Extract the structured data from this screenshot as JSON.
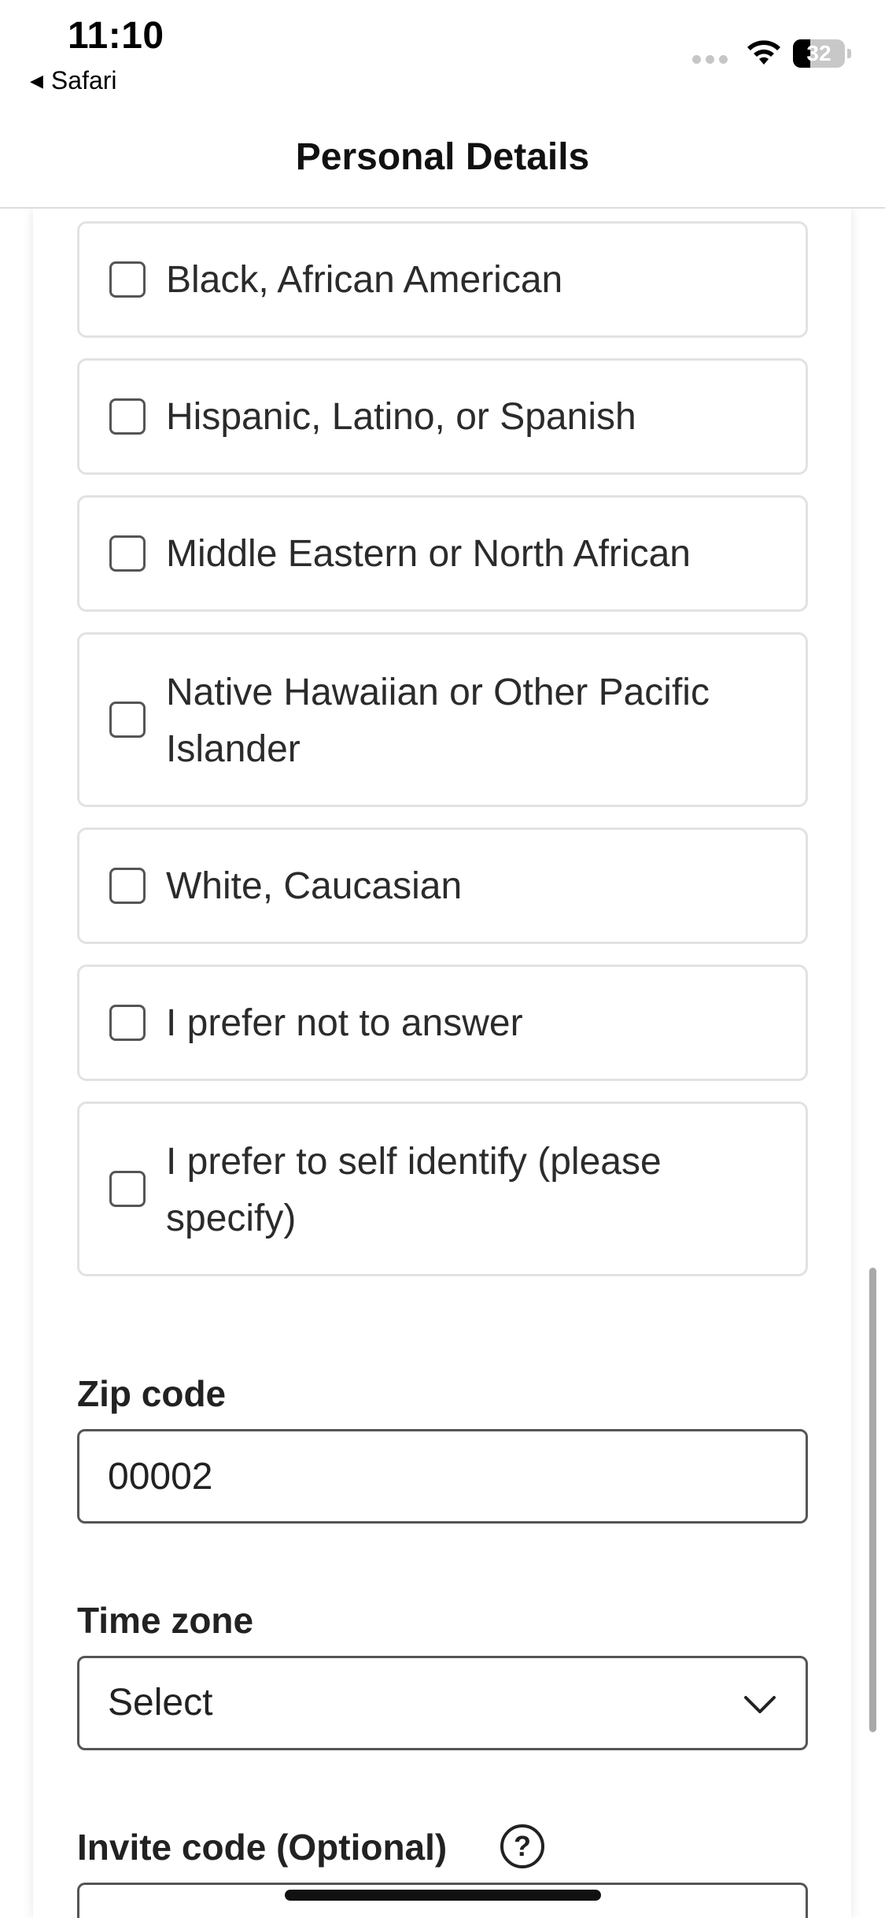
{
  "status_bar": {
    "time": "11:10",
    "back_app": "Safari",
    "battery": "32"
  },
  "header": {
    "title": "Personal Details"
  },
  "ethnicity_options": [
    "Black, African American",
    "Hispanic, Latino, or Spanish",
    "Middle Eastern or North African",
    "Native Hawaiian or Other Pacific Islander",
    "White, Caucasian",
    "I prefer not to answer",
    "I prefer to self identify (please specify)"
  ],
  "zip": {
    "label": "Zip code",
    "value": "00002"
  },
  "timezone": {
    "label": "Time zone",
    "value": "Select"
  },
  "invite": {
    "label": "Invite code (Optional)",
    "help": "?"
  },
  "icons": {
    "back": "back-arrow-icon",
    "wifi": "wifi-icon",
    "battery": "battery-icon",
    "chevron": "chevron-down-icon",
    "help": "help-circle-icon"
  }
}
